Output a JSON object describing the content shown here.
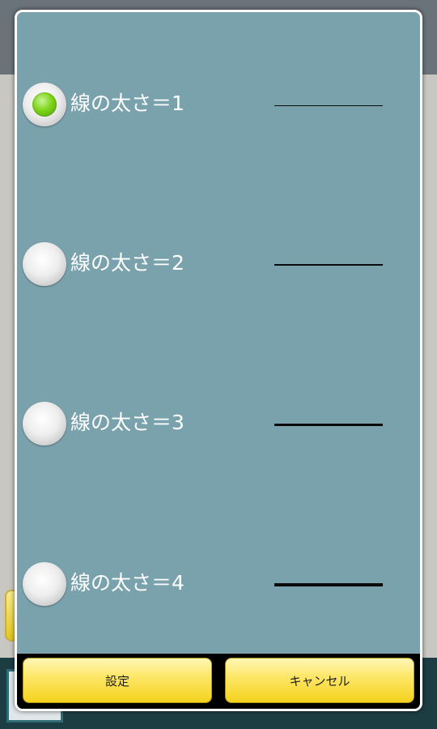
{
  "dialog": {
    "options": [
      {
        "label": "線の太さ＝1",
        "selected": true
      },
      {
        "label": "線の太さ＝2",
        "selected": false
      },
      {
        "label": "線の太さ＝3",
        "selected": false
      },
      {
        "label": "線の太さ＝4",
        "selected": false
      }
    ],
    "buttons": {
      "ok_label": "設定",
      "cancel_label": "キャンセル"
    }
  },
  "colors": {
    "dialog_background": "#7aa2ad",
    "button_yellow": "#fde76a",
    "radio_selected": "#7fd51a"
  }
}
